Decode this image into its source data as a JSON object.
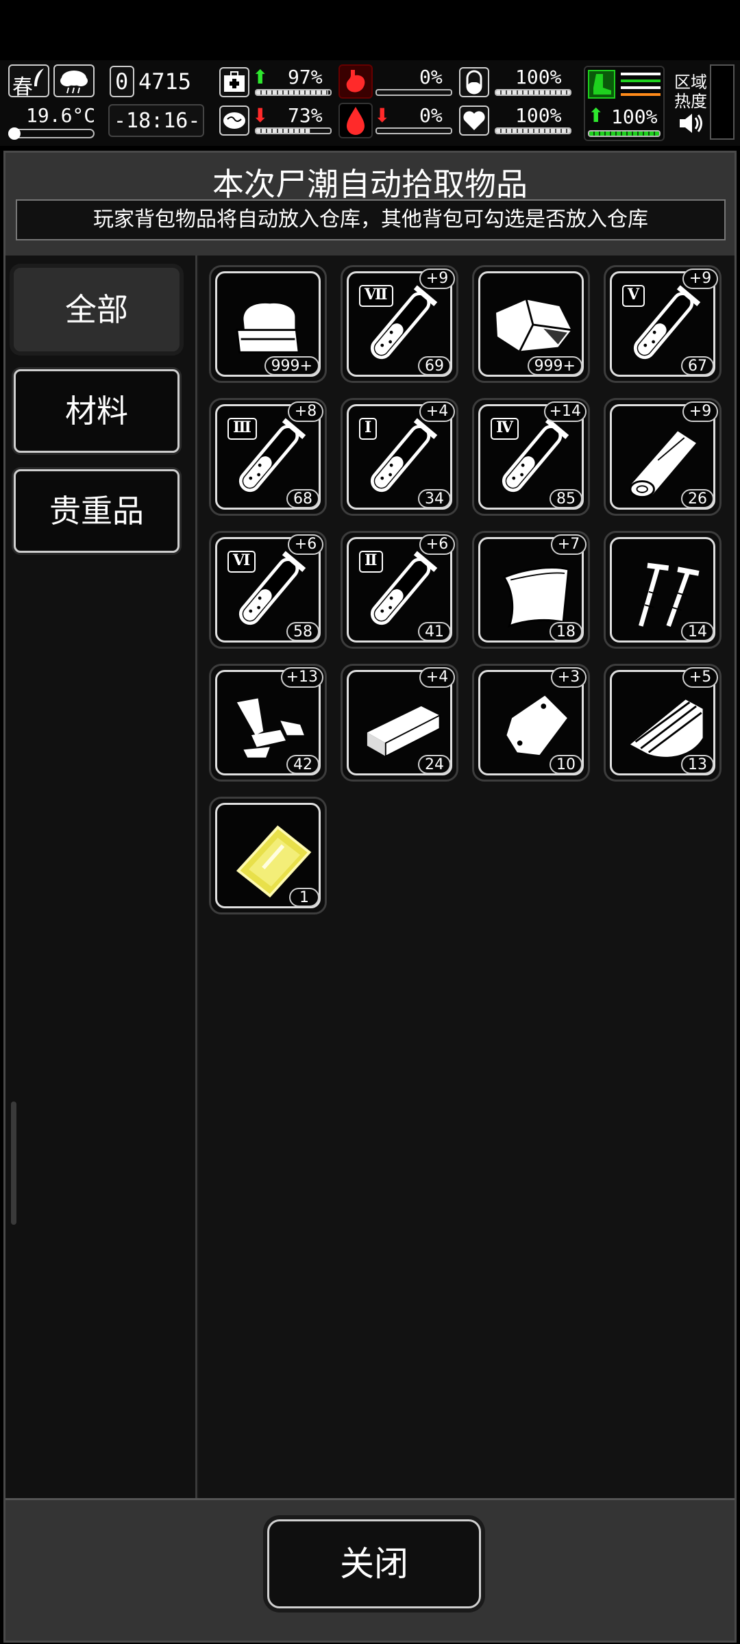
{
  "hud": {
    "season": "春",
    "temperature": "19.6°C",
    "day_counter": "4715",
    "day_digit": "0",
    "clock": "-18:16-",
    "health_pct": "97%",
    "hunger_pct": "0%",
    "pill_pct": "100%",
    "mind_pct": "73%",
    "blood_pct": "0%",
    "heart_pct": "100%",
    "stamina_pct": "100%",
    "area_heat_label": "区域热度"
  },
  "dialog": {
    "title": "本次尸潮自动拾取物品",
    "subtitle": "玩家背包物品将自动放入仓库，其他背包可勾选是否放入仓库",
    "tabs": [
      "全部",
      "材料",
      "贵重品"
    ],
    "close_label": "关闭"
  },
  "items": [
    {
      "icon": "cloth-icon",
      "count": "999+",
      "badge": "",
      "roman": ""
    },
    {
      "icon": "test-tube-icon",
      "count": "69",
      "badge": "+9",
      "roman": "Ⅶ"
    },
    {
      "icon": "ore-rock-icon",
      "count": "999+",
      "badge": "",
      "roman": ""
    },
    {
      "icon": "test-tube-icon",
      "count": "67",
      "badge": "+9",
      "roman": "Ⅴ"
    },
    {
      "icon": "test-tube-icon",
      "count": "68",
      "badge": "+8",
      "roman": "Ⅲ"
    },
    {
      "icon": "test-tube-icon",
      "count": "34",
      "badge": "+4",
      "roman": "Ⅰ"
    },
    {
      "icon": "test-tube-icon",
      "count": "85",
      "badge": "+14",
      "roman": "Ⅳ"
    },
    {
      "icon": "wood-log-icon",
      "count": "26",
      "badge": "+9",
      "roman": ""
    },
    {
      "icon": "test-tube-icon",
      "count": "58",
      "badge": "+6",
      "roman": "Ⅵ"
    },
    {
      "icon": "test-tube-icon",
      "count": "41",
      "badge": "+6",
      "roman": "Ⅱ"
    },
    {
      "icon": "metal-sheet-icon",
      "count": "18",
      "badge": "+7",
      "roman": ""
    },
    {
      "icon": "screws-icon",
      "count": "14",
      "badge": "",
      "roman": ""
    },
    {
      "icon": "scrap-parts-icon",
      "count": "42",
      "badge": "+13",
      "roman": ""
    },
    {
      "icon": "brick-icon",
      "count": "24",
      "badge": "+4",
      "roman": ""
    },
    {
      "icon": "plastic-bag-icon",
      "count": "10",
      "badge": "+3",
      "roman": ""
    },
    {
      "icon": "wood-planks-icon",
      "count": "13",
      "badge": "+5",
      "roman": ""
    },
    {
      "icon": "gold-plate-icon",
      "count": "1",
      "badge": "",
      "roman": ""
    }
  ],
  "colors": {
    "accent_green": "#1ed11e",
    "alert_red": "#ff2a2a",
    "gold": "#e8e04a"
  }
}
